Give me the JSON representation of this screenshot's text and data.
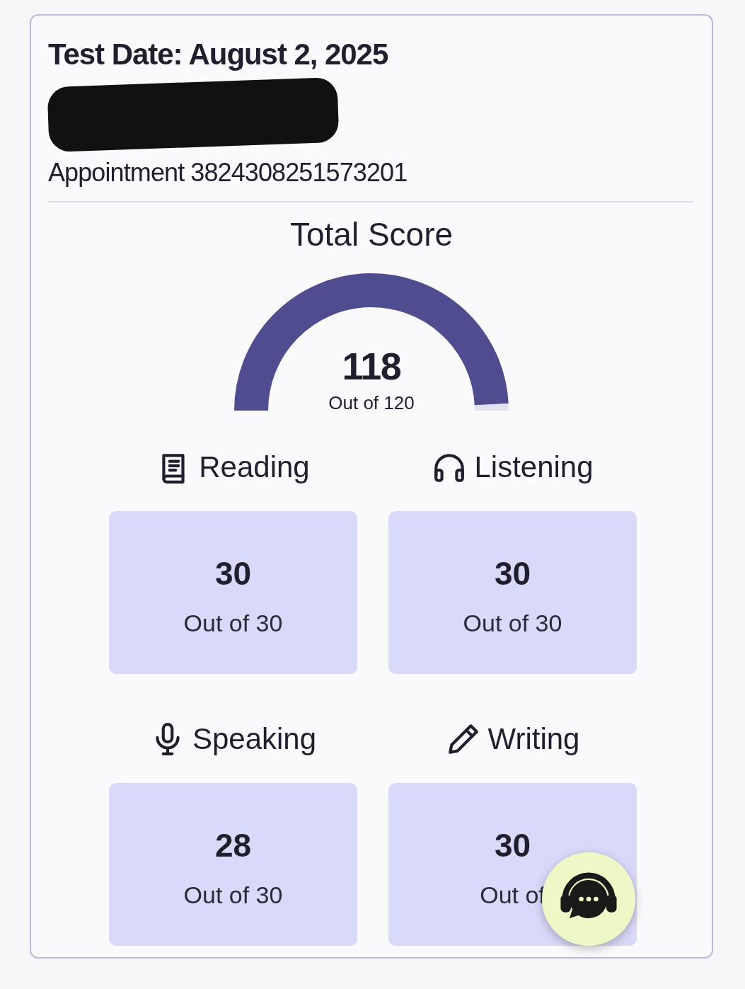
{
  "header": {
    "title": "Test Date: August 2, 2025",
    "redacted": true,
    "appointment": "Appointment 3824308251573201"
  },
  "total": {
    "title": "Total Score",
    "score": "118",
    "out_of": "Out of 120"
  },
  "sections": [
    {
      "kind": "reading",
      "label": "Reading",
      "score": "30",
      "out_of": "Out of 30"
    },
    {
      "kind": "listening",
      "label": "Listening",
      "score": "30",
      "out_of": "Out of 30"
    },
    {
      "kind": "speaking",
      "label": "Speaking",
      "score": "28",
      "out_of": "Out of 30"
    },
    {
      "kind": "writing",
      "label": "Writing",
      "score": "30",
      "out_of": "Out of"
    }
  ],
  "support_button": {
    "visible": true
  }
}
